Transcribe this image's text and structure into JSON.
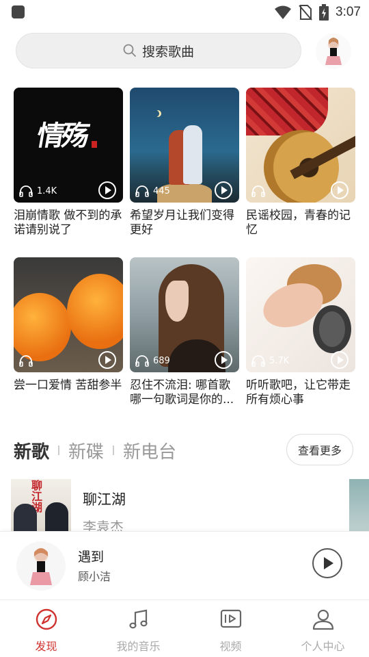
{
  "status_bar": {
    "time": "3:07"
  },
  "search": {
    "placeholder": "搜索歌曲"
  },
  "playlists": [
    {
      "title": "泪崩情歌 做不到的承诺请别说了",
      "plays": "1.4K",
      "cover_text": "情殇"
    },
    {
      "title": "希望岁月让我们变得更好",
      "plays": "445"
    },
    {
      "title": "民谣校园，青春的记忆",
      "plays": ""
    },
    {
      "title": "尝一口爱情 苦甜参半",
      "plays": ""
    },
    {
      "title": "忍住不流泪: 哪首歌哪一句歌词是你的...",
      "plays": "689"
    },
    {
      "title": "听听歌吧，让它带走所有烦心事",
      "plays": "5.7K"
    }
  ],
  "section_tabs": [
    {
      "label": "新歌",
      "active": true
    },
    {
      "label": "新碟",
      "active": false
    },
    {
      "label": "新电台",
      "active": false
    }
  ],
  "more_button": "查看更多",
  "new_songs": [
    {
      "title": "聊江湖",
      "artist": "李袁杰",
      "art_text": "聊江湖"
    }
  ],
  "now_playing": {
    "title": "遇到",
    "artist": "顾小洁"
  },
  "bottom_nav": [
    {
      "label": "发现",
      "icon": "compass-icon",
      "active": true
    },
    {
      "label": "我的音乐",
      "icon": "music-note-icon",
      "active": false
    },
    {
      "label": "视频",
      "icon": "video-icon",
      "active": false
    },
    {
      "label": "个人中心",
      "icon": "person-icon",
      "active": false
    }
  ],
  "colors": {
    "accent": "#d0332f",
    "muted": "#aaaaaa"
  }
}
